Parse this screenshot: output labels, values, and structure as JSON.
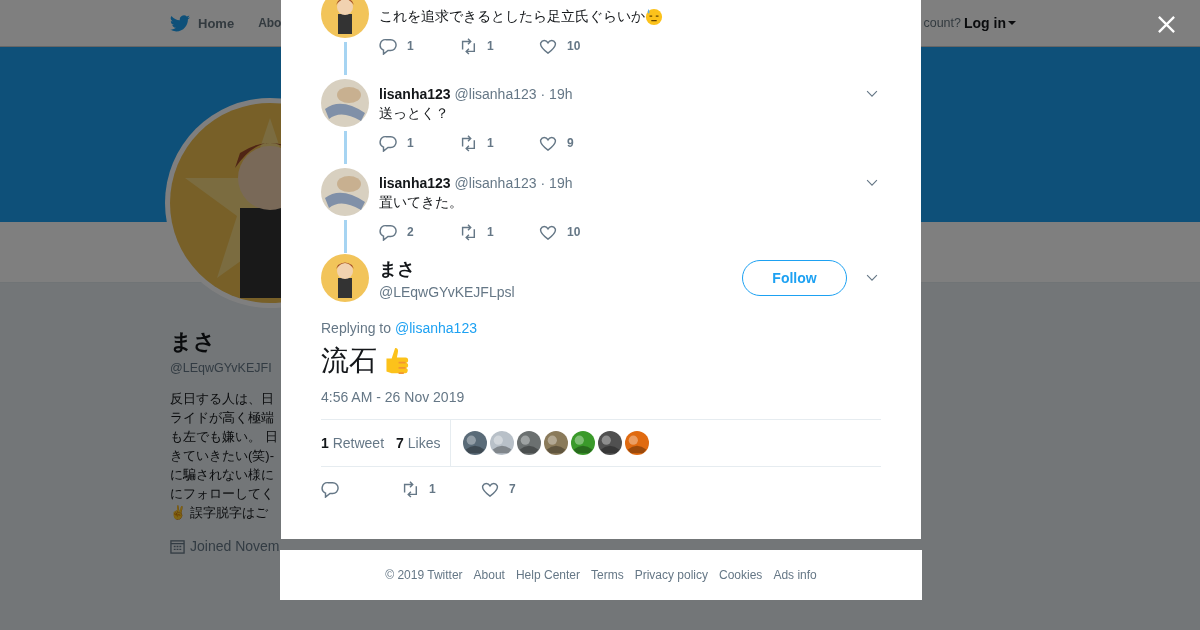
{
  "nav": {
    "home": "Home",
    "about": "Abo",
    "account_prompt": "count?",
    "login": "Log in"
  },
  "profile": {
    "name": "まさ",
    "handle": "@LEqwGYvKEJFI",
    "bio_lines": [
      "反日する人は、日",
      "ライドが高く極端",
      "も左でも嫌い。 日",
      "きていきたい(笑)-",
      "に騙されない様に",
      "にフォローしてく",
      "✌ 誤字脱字はご"
    ],
    "joined": "Joined Novem"
  },
  "thread": [
    {
      "text": "これを追求できるとしたら足立氏ぐらいか",
      "emoji": true,
      "replies": "1",
      "retweets": "1",
      "likes": "10"
    },
    {
      "name": "lisanha123",
      "handle": "@lisanha123",
      "time": "· 19h",
      "text": "送っとく？",
      "emoji": false,
      "replies": "1",
      "retweets": "1",
      "likes": "9"
    },
    {
      "name": "lisanha123",
      "handle": "@lisanha123",
      "time": "· 19h",
      "text": "置いてきた。",
      "emoji": false,
      "replies": "2",
      "retweets": "1",
      "likes": "10"
    }
  ],
  "main_tweet": {
    "name": "まさ",
    "handle": "@LEqwGYvKEJFLpsl",
    "follow": "Follow",
    "replying_label": "Replying to",
    "replying_handle": "@lisanha123",
    "text": "流石",
    "timestamp": "4:56 AM - 26 Nov 2019",
    "stats": [
      {
        "count": "1",
        "label": "Retweet"
      },
      {
        "count": "7",
        "label": "Likes"
      }
    ],
    "likers": [
      {
        "color": "#5a6b78"
      },
      {
        "color": "#b8c0c8"
      },
      {
        "color": "#6b7070"
      },
      {
        "color": "#8a7a5a"
      },
      {
        "color": "#3a9a2a"
      },
      {
        "color": "#505050"
      },
      {
        "color": "#e06a10"
      }
    ],
    "retweets": "1",
    "likes": "7"
  },
  "footer": [
    "© 2019 Twitter",
    "About",
    "Help Center",
    "Terms",
    "Privacy policy",
    "Cookies",
    "Ads info"
  ]
}
